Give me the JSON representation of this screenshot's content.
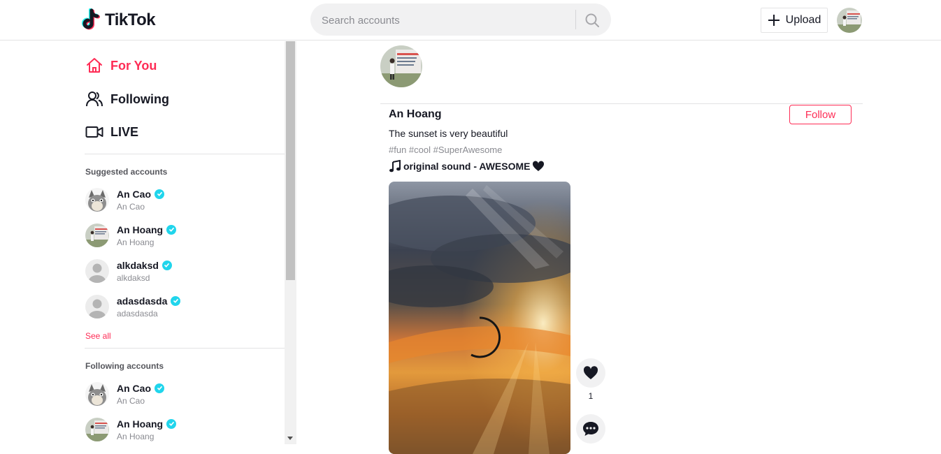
{
  "header": {
    "logo_text": "TikTok",
    "search_placeholder": "Search accounts",
    "upload_label": "Upload"
  },
  "sidebar": {
    "nav": [
      {
        "label": "For You",
        "icon": "home-icon",
        "active": true
      },
      {
        "label": "Following",
        "icon": "users-icon",
        "active": false
      },
      {
        "label": "LIVE",
        "icon": "live-camera-icon",
        "active": false
      }
    ],
    "suggested_title": "Suggested accounts",
    "suggested": [
      {
        "name": "An Cao",
        "handle": "An Cao",
        "verified": true
      },
      {
        "name": "An Hoang",
        "handle": "An Hoang",
        "verified": true
      },
      {
        "name": "alkdaksd",
        "handle": "alkdaksd",
        "verified": true
      },
      {
        "name": "adasdasda",
        "handle": "adasdasda",
        "verified": true
      }
    ],
    "see_all": "See all",
    "following_title": "Following accounts",
    "following": [
      {
        "name": "An Cao",
        "handle": "An Cao",
        "verified": true
      },
      {
        "name": "An Hoang",
        "handle": "An Hoang",
        "verified": true
      }
    ]
  },
  "post": {
    "author": "An Hoang",
    "follow_label": "Follow",
    "caption": "The sunset is very beautiful",
    "hashtags": "#fun #cool #SuperAwesome",
    "sound": "original sound - AWESOME",
    "like_count": "1"
  },
  "colors": {
    "accent": "#fe2c55",
    "verified": "#20d5ec",
    "text": "#161823",
    "muted": "#8a8b91"
  }
}
